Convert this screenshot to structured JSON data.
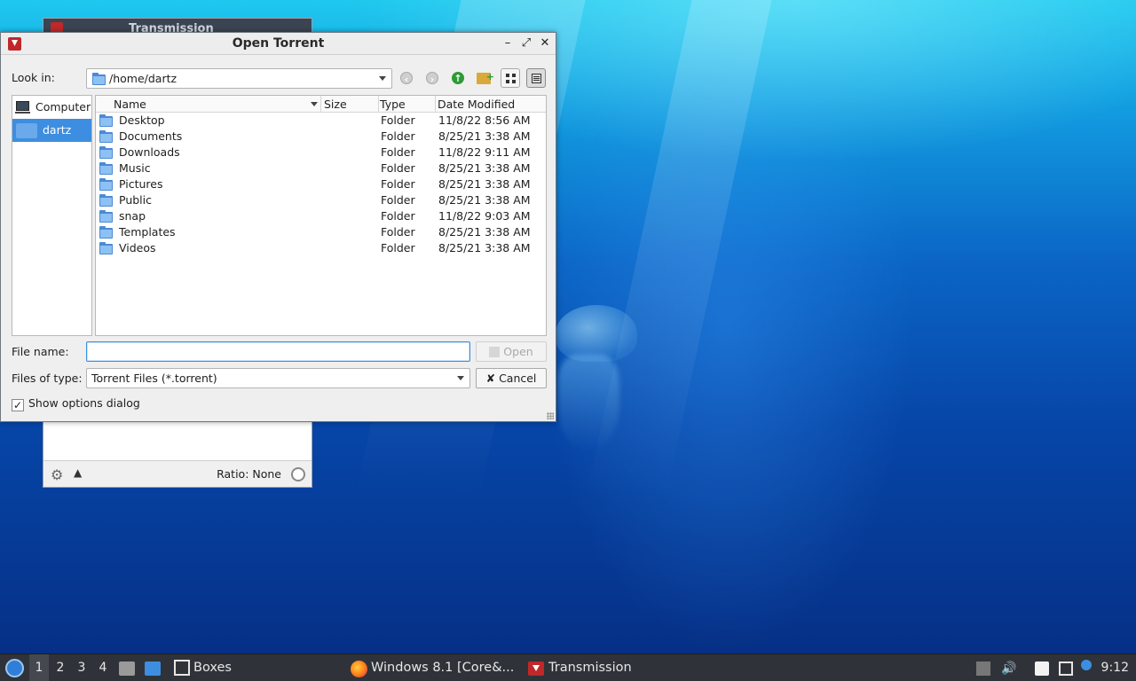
{
  "background_window": {
    "title": "Transmission",
    "status_ratio": "Ratio: None"
  },
  "dialog": {
    "title": "Open Torrent",
    "look_in_label": "Look in:",
    "look_in_value": "/home/dartz",
    "sidebar": [
      {
        "label": "Computer",
        "icon": "computer-icon",
        "selected": false
      },
      {
        "label": "dartz",
        "icon": "home-folder-icon",
        "selected": true
      }
    ],
    "columns": [
      "Name",
      "Size",
      "Type",
      "Date Modified"
    ],
    "files": [
      {
        "name": "Desktop",
        "size": "",
        "type": "Folder",
        "date": "11/8/22 8:56 AM"
      },
      {
        "name": "Documents",
        "size": "",
        "type": "Folder",
        "date": "8/25/21 3:38 AM"
      },
      {
        "name": "Downloads",
        "size": "",
        "type": "Folder",
        "date": "11/8/22 9:11 AM"
      },
      {
        "name": "Music",
        "size": "",
        "type": "Folder",
        "date": "8/25/21 3:38 AM"
      },
      {
        "name": "Pictures",
        "size": "",
        "type": "Folder",
        "date": "8/25/21 3:38 AM"
      },
      {
        "name": "Public",
        "size": "",
        "type": "Folder",
        "date": "8/25/21 3:38 AM"
      },
      {
        "name": "snap",
        "size": "",
        "type": "Folder",
        "date": "11/8/22 9:03 AM"
      },
      {
        "name": "Templates",
        "size": "",
        "type": "Folder",
        "date": "8/25/21 3:38 AM"
      },
      {
        "name": "Videos",
        "size": "",
        "type": "Folder",
        "date": "8/25/21 3:38 AM"
      }
    ],
    "file_name_label": "File name:",
    "file_name_value": "",
    "open_button": "Open",
    "files_of_type_label": "Files of type:",
    "files_of_type_value": "Torrent Files (*.torrent)",
    "cancel_button": "Cancel",
    "show_options_label": "Show options dialog",
    "show_options_checked": true
  },
  "taskbar": {
    "workspaces": [
      "1",
      "2",
      "3",
      "4"
    ],
    "current_workspace": "1",
    "tasks": [
      {
        "label": "Boxes",
        "icon": "boxes-icon"
      },
      {
        "label": "Windows 8.1 [Core&...",
        "icon": "firefox-icon"
      },
      {
        "label": "Transmission",
        "icon": "transmission-icon"
      }
    ],
    "clock": "9:12"
  },
  "colors": {
    "accent": "#3d8ee0",
    "taskbar_bg": "#2f3339",
    "dialog_bg": "#efefef"
  }
}
